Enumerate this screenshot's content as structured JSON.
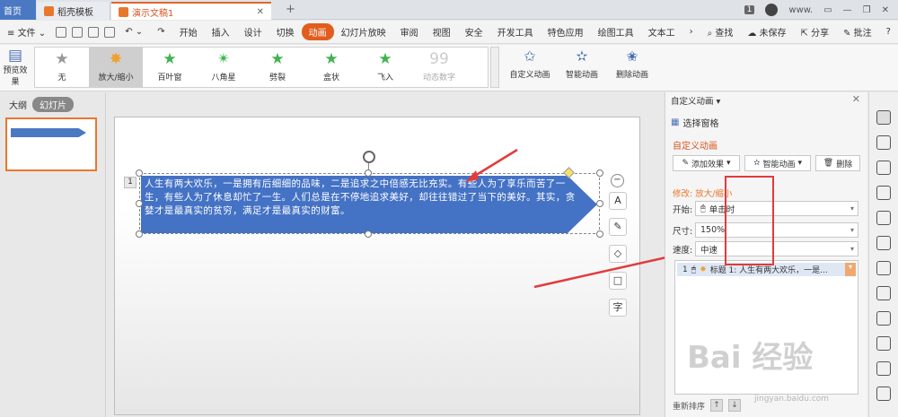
{
  "tabs": {
    "home": "首页",
    "template": "稻壳模板",
    "doc": "演示文稿1",
    "add": "+"
  },
  "window": {
    "badge": "1",
    "user": "www."
  },
  "menu": {
    "file": "文件",
    "items": [
      "开始",
      "插入",
      "设计",
      "切换",
      "动画",
      "幻灯片放映",
      "审阅",
      "视图",
      "安全",
      "开发工具",
      "特色应用",
      "绘图工具",
      "文本工"
    ],
    "active": "动画",
    "search": "查找",
    "unsaved": "未保存",
    "share": "分享",
    "comment": "批注",
    "help": "?"
  },
  "ribbon": {
    "preview": "预览效果",
    "effects": [
      {
        "label": "无",
        "icon": "star-gray-icon"
      },
      {
        "label": "放大/缩小",
        "icon": "star-burst-icon"
      },
      {
        "label": "百叶窗",
        "icon": "star-green-icon"
      },
      {
        "label": "八角星",
        "icon": "octagram-icon"
      },
      {
        "label": "劈裂",
        "icon": "star-green-icon"
      },
      {
        "label": "盒状",
        "icon": "star-green-icon"
      },
      {
        "label": "飞入",
        "icon": "star-green-icon"
      },
      {
        "label": "动态数字",
        "icon": "number-icon"
      }
    ],
    "custom": "自定义动画",
    "smart": "智能动画",
    "delete": "删除动画"
  },
  "leftpane": {
    "outline": "大纲",
    "slides": "幻灯片"
  },
  "slide": {
    "text": "人生有两大欢乐，一是拥有后细细的品味，二是追求之中倍感无比充实。有些人为了享乐而苦了一生，有些人为了休息却忙了一生。人们总是在不停地追求美好，却往往错过了当下的美好。其实，贪婪才是最真实的贫穷，满足才是最真实的财富。",
    "number": "1"
  },
  "rightpane": {
    "title": "自定义动画",
    "select": "选择窗格",
    "custom": "自定义动画",
    "add_effect": "添加效果",
    "smart_anim": "智能动画",
    "delete": "删除",
    "modify": "修改: 放大/缩小",
    "start_label": "开始:",
    "start_value": "单击时",
    "size_label": "尺寸:",
    "size_value": "150%",
    "speed_label": "速度:",
    "speed_value": "中速",
    "item_num": "1",
    "item_label": "标题 1: 人生有两大欢乐，一是...",
    "reorder": "重新排序"
  },
  "watermark": {
    "main": "Bai 经验",
    "sub": "jingyan.baidu.com"
  },
  "colors": {
    "accent": "#e25d1d",
    "shape": "#4472c4",
    "annotation": "#e23b3b"
  }
}
